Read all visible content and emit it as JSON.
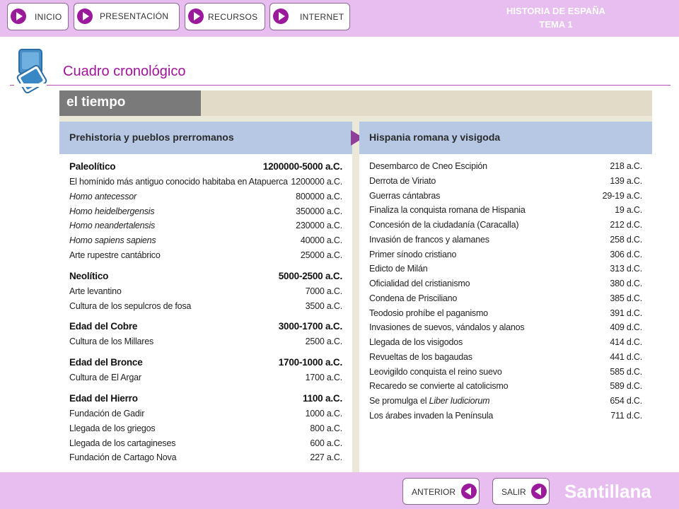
{
  "nav": {
    "inicio": "INICIO",
    "presentacion": "PRESENTACIÓN",
    "recursos": "RECURSOS",
    "internet": "INTERNET"
  },
  "header": {
    "subject": "HISTORIA DE ESPAÑA",
    "unit": "TEMA 1"
  },
  "page": {
    "title": "Cuadro cronológico"
  },
  "panel": {
    "tab_label": "el tiempo",
    "left_heading": "Prehistoria y pueblos prerromanos",
    "right_heading": "Hispania romana y visigoda",
    "left_rows": [
      {
        "event": "Paleolítico",
        "date": "1200000-5000 a.C.",
        "kind": "header"
      },
      {
        "event": "El homínido más antiguo conocido habitaba en Atapuerca",
        "date": "1200000 a.C.",
        "kind": "normal"
      },
      {
        "event": "Homo antecessor",
        "date": "800000 a.C.",
        "kind": "italic"
      },
      {
        "event": "Homo heidelbergensis",
        "date": "350000 a.C.",
        "kind": "italic"
      },
      {
        "event": "Homo neandertalensis",
        "date": "230000 a.C.",
        "kind": "italic"
      },
      {
        "event": "Homo sapiens sapiens",
        "date": "40000 a.C.",
        "kind": "italic"
      },
      {
        "event": "Arte rupestre cantábrico",
        "date": "25000 a.C.",
        "kind": "normal"
      },
      {
        "event": "Neolítico",
        "date": "5000-2500 a.C.",
        "kind": "header"
      },
      {
        "event": "Arte levantino",
        "date": "7000 a.C.",
        "kind": "normal"
      },
      {
        "event": "Cultura de los sepulcros de fosa",
        "date": "3500 a.C.",
        "kind": "normal"
      },
      {
        "event": "Edad del Cobre",
        "date": "3000-1700 a.C.",
        "kind": "header"
      },
      {
        "event": "Cultura de los Millares",
        "date": "2500 a.C.",
        "kind": "normal"
      },
      {
        "event": "Edad del Bronce",
        "date": "1700-1000 a.C.",
        "kind": "header"
      },
      {
        "event": "Cultura de El Argar",
        "date": "1700 a.C.",
        "kind": "normal"
      },
      {
        "event": "Edad del Hierro",
        "date": "1100 a.C.",
        "kind": "header"
      },
      {
        "event": "Fundación de Gadir",
        "date": "1000 a.C.",
        "kind": "normal"
      },
      {
        "event": "Llegada de los griegos",
        "date": "800 a.C.",
        "kind": "normal"
      },
      {
        "event": "Llegada de los cartagineses",
        "date": "600 a.C.",
        "kind": "normal"
      },
      {
        "event": "Fundación de Cartago Nova",
        "date": "227 a.C.",
        "kind": "normal"
      }
    ],
    "right_rows": [
      {
        "event": "Desembarco de Cneo Escipión",
        "date": "218 a.C."
      },
      {
        "event": "Derrota de Viriato",
        "date": "139 a.C."
      },
      {
        "event": "Guerras cántabras",
        "date": "29-19 a.C."
      },
      {
        "event": "Finaliza la conquista romana de Hispania",
        "date": "19 a.C."
      },
      {
        "event": "Concesión de la ciudadanía (Caracalla)",
        "date": "212 d.C."
      },
      {
        "event": "Invasión de francos y alamanes",
        "date": "258 d.C."
      },
      {
        "event": "Primer sínodo cristiano",
        "date": "306 d.C."
      },
      {
        "event": "Edicto de Milán",
        "date": "313 d.C."
      },
      {
        "event": "Oficialidad del cristianismo",
        "date": "380 d.C."
      },
      {
        "event": "Condena de Prisciliano",
        "date": "385 d.C."
      },
      {
        "event": "Teodosio prohíbe el paganismo",
        "date": "391 d.C."
      },
      {
        "event": "Invasiones de suevos, vándalos y alanos",
        "date": "409 d.C."
      },
      {
        "event": "Llegada de los visigodos",
        "date": "414 d.C."
      },
      {
        "event": "Revueltas de los bagaudas",
        "date": "441 d.C."
      },
      {
        "event": "Leovigildo conquista el reino suevo",
        "date": "585 d.C."
      },
      {
        "event": "Recaredo se convierte al catolicismo",
        "date": "589 d.C."
      },
      {
        "event": "Se promulga el Liber Iudiciorum",
        "date": "654 d.C.",
        "prefix": "Se promulga el ",
        "italic_part": "Liber Iudiciorum"
      },
      {
        "event": "Los árabes invaden la Península",
        "date": "711 d.C."
      }
    ]
  },
  "footer": {
    "anterior": "ANTERIOR",
    "salir": "SALIR",
    "publisher": "Santillana"
  },
  "colors": {
    "bar": "#e8bdf0",
    "accent": "#9b1a9b",
    "title": "#a0139a",
    "column_header": "#b6c8e4",
    "panel_tab": "#7a7a7a"
  },
  "icons": {
    "nav_arrow": "play-arrow-icon",
    "footer_arrow": "back-arrow-icon",
    "heading": "screens-icon",
    "divider": "triangle-arrow-icon"
  }
}
